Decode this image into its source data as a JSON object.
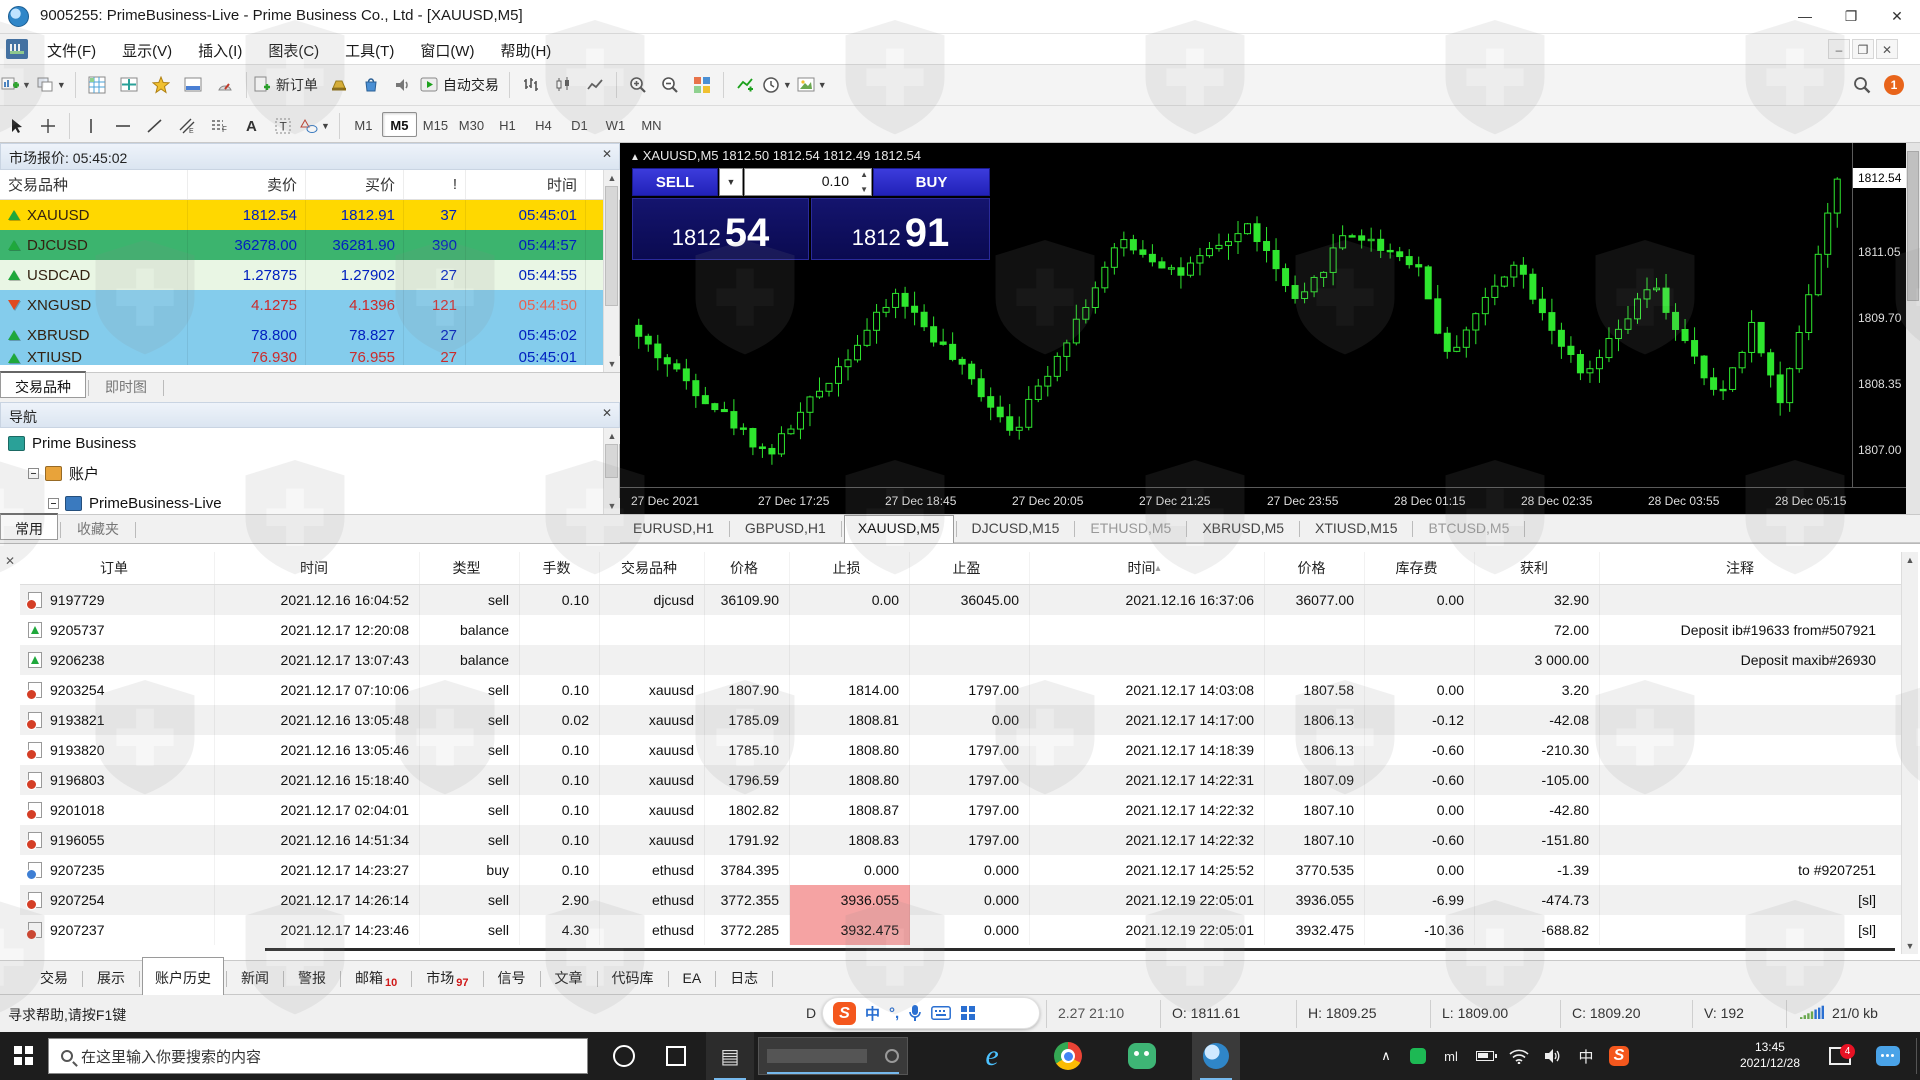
{
  "window": {
    "title": "9005255: PrimeBusiness-Live - Prime Business Co., Ltd - [XAUUSD,M5]",
    "minimize": "—",
    "maximize": "❐",
    "close": "✕"
  },
  "menu": {
    "items": [
      "文件(F)",
      "显示(V)",
      "插入(I)",
      "图表(C)",
      "工具(T)",
      "窗口(W)",
      "帮助(H)"
    ]
  },
  "toolbar": {
    "new_order_label": "新订单",
    "autotrading_label": "自动交易",
    "notification_count": "1",
    "timeframes": [
      "M1",
      "M5",
      "M15",
      "M30",
      "H1",
      "H4",
      "D1",
      "W1",
      "MN"
    ],
    "active_timeframe": "M5"
  },
  "market_watch": {
    "title": "市场报价: 05:45:02",
    "columns": [
      "交易品种",
      "卖价",
      "买价",
      "!",
      "时间"
    ],
    "rows": [
      {
        "symbol": "XAUUSD",
        "bid": "1812.54",
        "ask": "1812.91",
        "spread": "37",
        "time": "05:45:01",
        "bg": "#ffd800",
        "dir": "up",
        "num_color": "#0020c0",
        "time_color": "#0020c0"
      },
      {
        "symbol": "DJCUSD",
        "bid": "36278.00",
        "ask": "36281.90",
        "spread": "390",
        "time": "05:44:57",
        "bg": "#3cb46e",
        "dir": "up",
        "num_color": "#0020c0",
        "time_color": "#0020c0"
      },
      {
        "symbol": "USDCAD",
        "bid": "1.27875",
        "ask": "1.27902",
        "spread": "27",
        "time": "05:44:55",
        "bg": "#e9f6e4",
        "dir": "up",
        "num_color": "#0020c0",
        "time_color": "#0020c0"
      },
      {
        "symbol": "XNGUSD",
        "bid": "4.1275",
        "ask": "4.1396",
        "spread": "121",
        "time": "05:44:50",
        "bg": "#84ccec",
        "dir": "down",
        "num_color": "#cc2a2a",
        "time_color": "#e8604f"
      },
      {
        "symbol": "XBRUSD",
        "bid": "78.800",
        "ask": "78.827",
        "spread": "27",
        "time": "05:45:02",
        "bg": "#84ccec",
        "dir": "up",
        "num_color": "#0020c0",
        "time_color": "#0020c0"
      },
      {
        "symbol": "XTIUSD",
        "bid": "76.930",
        "ask": "76.955",
        "spread": "27",
        "time": "05:45:01",
        "bg": "#84ccec",
        "dir": "up",
        "num_color": "#cc2a2a",
        "time_color": "#0020c0",
        "partial": true
      }
    ],
    "tabs": [
      {
        "label": "交易品种",
        "active": true
      },
      {
        "label": "即时图",
        "active": false
      }
    ]
  },
  "navigator": {
    "title": "导航",
    "tree": [
      {
        "label": "Prime Business",
        "icon": "chart",
        "indent": 0,
        "expander": false
      },
      {
        "label": "账户",
        "icon": "accounts",
        "indent": 1,
        "expander": true
      },
      {
        "label": "PrimeBusiness-Live",
        "icon": "account",
        "indent": 2,
        "expander": true
      }
    ],
    "tabs": [
      {
        "label": "常用",
        "active": true
      },
      {
        "label": "收藏夹",
        "active": false
      }
    ]
  },
  "chart": {
    "header": "XAUUSD,M5  1812.50 1812.54 1812.49 1812.54",
    "sell_label": "SELL",
    "buy_label": "BUY",
    "volume": "0.10",
    "sell_big": [
      "1812",
      "54"
    ],
    "buy_big": [
      "1812",
      "91"
    ],
    "current_price": "1812.54",
    "tabs": [
      {
        "label": "EURUSD,H1"
      },
      {
        "label": "GBPUSD,H1"
      },
      {
        "label": "XAUUSD,M5",
        "active": true
      },
      {
        "label": "DJCUSD,M15"
      },
      {
        "label": "ETHUSD,M5",
        "dim": true
      },
      {
        "label": "XBRUSD,M5"
      },
      {
        "label": "XTIUSD,M15"
      },
      {
        "label": "BTCUSD,M5",
        "dim": true
      }
    ]
  },
  "chart_data": {
    "type": "candlestick",
    "symbol": "XAUUSD",
    "period": "M5",
    "title": "XAUUSD,M5",
    "ohlc_header": {
      "open": 1812.5,
      "high": 1812.54,
      "low": 1812.49,
      "close": 1812.54
    },
    "current_price": 1812.54,
    "ylim": [
      1806.3,
      1813.3
    ],
    "grid": false,
    "price_ticks": [
      1811.05,
      1809.7,
      1808.35,
      1807.0
    ],
    "time_ticks": [
      "27 Dec 2021",
      "27 Dec 17:25",
      "27 Dec 18:45",
      "27 Dec 20:05",
      "27 Dec 21:25",
      "27 Dec 23:55",
      "28 Dec 01:15",
      "28 Dec 02:35",
      "28 Dec 03:55",
      "28 Dec 05:15"
    ],
    "anchors": [
      [
        0,
        1809.3
      ],
      [
        0.108,
        1806.9
      ],
      [
        0.215,
        1810.2
      ],
      [
        0.313,
        1807.4
      ],
      [
        0.403,
        1811.3
      ],
      [
        0.452,
        1810.6
      ],
      [
        0.51,
        1811.6
      ],
      [
        0.55,
        1809.9
      ],
      [
        0.59,
        1811.5
      ],
      [
        0.65,
        1810.8
      ],
      [
        0.674,
        1808.9
      ],
      [
        0.73,
        1810.9
      ],
      [
        0.788,
        1808.4
      ],
      [
        0.845,
        1810.4
      ],
      [
        0.9,
        1808.0
      ],
      [
        0.93,
        1809.6
      ],
      [
        0.952,
        1807.9
      ],
      [
        1,
        1812.54
      ]
    ],
    "n_candles": 127,
    "up_color": "#2ee62e",
    "bg_color": "#000000"
  },
  "terminal": {
    "columns": [
      "订单",
      "时间",
      "类型",
      "手数",
      "交易品种",
      "价格",
      "止损",
      "止盈",
      "时间",
      "价格",
      "库存费",
      "获利",
      "注释"
    ],
    "sort_column_index": 8,
    "rows": [
      {
        "icon": "sell",
        "order": "9197729",
        "time": "2021.12.16 16:04:52",
        "type": "sell",
        "vol": "0.10",
        "sym": "djcusd",
        "price": "36109.90",
        "sl": "0.00",
        "tp": "36045.00",
        "time2": "2021.12.16 16:37:06",
        "price2": "36077.00",
        "swap": "0.00",
        "profit": "32.90",
        "comment": ""
      },
      {
        "icon": "balance",
        "order": "9205737",
        "time": "2021.12.17 12:20:08",
        "type": "balance",
        "vol": "",
        "sym": "",
        "price": "",
        "sl": "",
        "tp": "",
        "time2": "",
        "price2": "",
        "swap": "",
        "profit": "72.00",
        "comment": "Deposit ib#19633 from#507921"
      },
      {
        "icon": "balance",
        "order": "9206238",
        "time": "2021.12.17 13:07:43",
        "type": "balance",
        "vol": "",
        "sym": "",
        "price": "",
        "sl": "",
        "tp": "",
        "time2": "",
        "price2": "",
        "swap": "",
        "profit": "3 000.00",
        "comment": "Deposit maxib#26930"
      },
      {
        "icon": "sell",
        "order": "9203254",
        "time": "2021.12.17 07:10:06",
        "type": "sell",
        "vol": "0.10",
        "sym": "xauusd",
        "price": "1807.90",
        "sl": "1814.00",
        "tp": "1797.00",
        "time2": "2021.12.17 14:03:08",
        "price2": "1807.58",
        "swap": "0.00",
        "profit": "3.20",
        "comment": ""
      },
      {
        "icon": "sell",
        "order": "9193821",
        "time": "2021.12.16 13:05:48",
        "type": "sell",
        "vol": "0.02",
        "sym": "xauusd",
        "price": "1785.09",
        "sl": "1808.81",
        "tp": "0.00",
        "time2": "2021.12.17 14:17:00",
        "price2": "1806.13",
        "swap": "-0.12",
        "profit": "-42.08",
        "comment": ""
      },
      {
        "icon": "sell",
        "order": "9193820",
        "time": "2021.12.16 13:05:46",
        "type": "sell",
        "vol": "0.10",
        "sym": "xauusd",
        "price": "1785.10",
        "sl": "1808.80",
        "tp": "1797.00",
        "time2": "2021.12.17 14:18:39",
        "price2": "1806.13",
        "swap": "-0.60",
        "profit": "-210.30",
        "comment": ""
      },
      {
        "icon": "sell",
        "order": "9196803",
        "time": "2021.12.16 15:18:40",
        "type": "sell",
        "vol": "0.10",
        "sym": "xauusd",
        "price": "1796.59",
        "sl": "1808.80",
        "tp": "1797.00",
        "time2": "2021.12.17 14:22:31",
        "price2": "1807.09",
        "swap": "-0.60",
        "profit": "-105.00",
        "comment": ""
      },
      {
        "icon": "sell",
        "order": "9201018",
        "time": "2021.12.17 02:04:01",
        "type": "sell",
        "vol": "0.10",
        "sym": "xauusd",
        "price": "1802.82",
        "sl": "1808.87",
        "tp": "1797.00",
        "time2": "2021.12.17 14:22:32",
        "price2": "1807.10",
        "swap": "0.00",
        "profit": "-42.80",
        "comment": ""
      },
      {
        "icon": "sell",
        "order": "9196055",
        "time": "2021.12.16 14:51:34",
        "type": "sell",
        "vol": "0.10",
        "sym": "xauusd",
        "price": "1791.92",
        "sl": "1808.83",
        "tp": "1797.00",
        "time2": "2021.12.17 14:22:32",
        "price2": "1807.10",
        "swap": "-0.60",
        "profit": "-151.80",
        "comment": ""
      },
      {
        "icon": "buy",
        "order": "9207235",
        "time": "2021.12.17 14:23:27",
        "type": "buy",
        "vol": "0.10",
        "sym": "ethusd",
        "price": "3784.395",
        "sl": "0.000",
        "tp": "0.000",
        "time2": "2021.12.17 14:25:52",
        "price2": "3770.535",
        "swap": "0.00",
        "profit": "-1.39",
        "comment": "to #9207251"
      },
      {
        "icon": "sell",
        "order": "9207254",
        "time": "2021.12.17 14:26:14",
        "type": "sell",
        "vol": "2.90",
        "sym": "ethusd",
        "price": "3772.355",
        "sl": "3936.055",
        "sl_hl": true,
        "tp": "0.000",
        "time2": "2021.12.19 22:05:01",
        "price2": "3936.055",
        "swap": "-6.99",
        "profit": "-474.73",
        "comment": "[sl]"
      },
      {
        "icon": "sell",
        "order": "9207237",
        "time": "2021.12.17 14:23:46",
        "type": "sell",
        "vol": "4.30",
        "sym": "ethusd",
        "price": "3772.285",
        "sl": "3932.475",
        "sl_hl": true,
        "tp": "0.000",
        "time2": "2021.12.19 22:05:01",
        "price2": "3932.475",
        "swap": "-10.36",
        "profit": "-688.82",
        "comment": "[sl]"
      }
    ]
  },
  "bottom_tabs": {
    "items": [
      {
        "label": "交易"
      },
      {
        "label": "展示"
      },
      {
        "label": "账户历史",
        "active": true
      },
      {
        "label": "新闻"
      },
      {
        "label": "警报"
      },
      {
        "label": "邮箱",
        "badge": "10"
      },
      {
        "label": "市场",
        "badge": "97"
      },
      {
        "label": "信号"
      },
      {
        "label": "文章"
      },
      {
        "label": "代码库"
      },
      {
        "label": "EA"
      },
      {
        "label": "日志"
      }
    ]
  },
  "status_bar": {
    "help": "寻求帮助,请按F1键",
    "profile": "D",
    "ime": {
      "logo": "S",
      "lang": "中",
      "punct": "°,"
    },
    "quote_time": "2.27 21:10",
    "o": "O: 1811.61",
    "h": "H: 1809.25",
    "l": "L: 1809.00",
    "c": "C: 1809.20",
    "v": "V: 192",
    "traffic": "21/0 kb"
  },
  "taskbar": {
    "search_placeholder": "在这里输入你要搜索的内容",
    "tray_text": "ml",
    "ime_lang": "中",
    "sogou": "S",
    "time": "13:45",
    "date": "2021/12/28",
    "badge": "4"
  }
}
